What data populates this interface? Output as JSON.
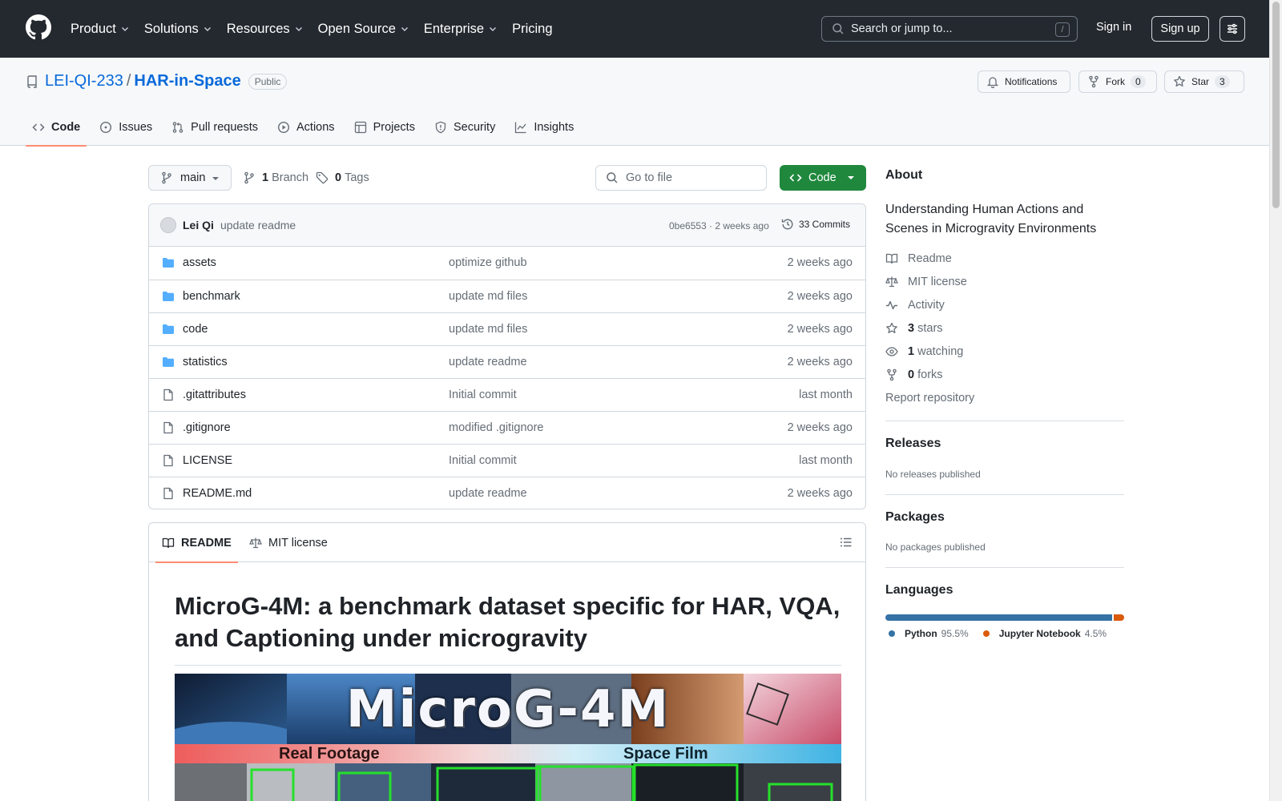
{
  "header": {
    "nav": [
      "Product",
      "Solutions",
      "Resources",
      "Open Source",
      "Enterprise",
      "Pricing"
    ],
    "search_placeholder": "Search or jump to...",
    "search_key": "/",
    "signin": "Sign in",
    "signup": "Sign up"
  },
  "repo": {
    "owner": "LEI-QI-233",
    "separator": "/",
    "name": "HAR-in-Space",
    "visibility": "Public",
    "notifications_label": "Notifications",
    "fork_label": "Fork",
    "fork_count": "0",
    "star_label": "Star",
    "star_count": "3",
    "tabs": [
      "Code",
      "Issues",
      "Pull requests",
      "Actions",
      "Projects",
      "Security",
      "Insights"
    ]
  },
  "toolbar": {
    "branch": "main",
    "branch_count": "1",
    "branch_label": "Branch",
    "tag_count": "0",
    "tag_label": "Tags",
    "goto_placeholder": "Go to file",
    "code_label": "Code"
  },
  "commit": {
    "author": "Lei Qi",
    "message": "update readme",
    "sha_time": "0be6553 · 2 weeks ago",
    "commits_label": "33 Commits"
  },
  "files": [
    {
      "type": "dir",
      "name": "assets",
      "message": "optimize github",
      "date": "2 weeks ago"
    },
    {
      "type": "dir",
      "name": "benchmark",
      "message": "update md files",
      "date": "2 weeks ago"
    },
    {
      "type": "dir",
      "name": "code",
      "message": "update md files",
      "date": "2 weeks ago"
    },
    {
      "type": "dir",
      "name": "statistics",
      "message": "update readme",
      "date": "2 weeks ago"
    },
    {
      "type": "file",
      "name": ".gitattributes",
      "message": "Initial commit",
      "date": "last month"
    },
    {
      "type": "file",
      "name": ".gitignore",
      "message": "modified .gitignore",
      "date": "2 weeks ago"
    },
    {
      "type": "file",
      "name": "LICENSE",
      "message": "Initial commit",
      "date": "last month"
    },
    {
      "type": "file",
      "name": "README.md",
      "message": "update readme",
      "date": "2 weeks ago"
    }
  ],
  "readme": {
    "tab_readme": "README",
    "tab_license": "MIT license",
    "title": "MicroG-4M: a benchmark dataset specific for HAR, VQA, and Captioning under microgravity",
    "banner_title": "MicroG-4M",
    "banner_left": "Real Footage",
    "banner_right": "Space Film"
  },
  "about": {
    "heading": "About",
    "description": "Understanding Human Actions and Scenes in Microgravity Environments",
    "readme": "Readme",
    "license": "MIT license",
    "activity": "Activity",
    "stars_count": "3",
    "stars_label": "stars",
    "watching_count": "1",
    "watching_label": "watching",
    "forks_count": "0",
    "forks_label": "forks",
    "report": "Report repository"
  },
  "releases": {
    "heading": "Releases",
    "note": "No releases published"
  },
  "packages": {
    "heading": "Packages",
    "note": "No packages published"
  },
  "languages": {
    "heading": "Languages",
    "items": [
      {
        "name": "Python",
        "percent": "95.5%",
        "color": "#3572A5"
      },
      {
        "name": "Jupyter Notebook",
        "percent": "4.5%",
        "color": "#DA5B0B"
      }
    ]
  }
}
